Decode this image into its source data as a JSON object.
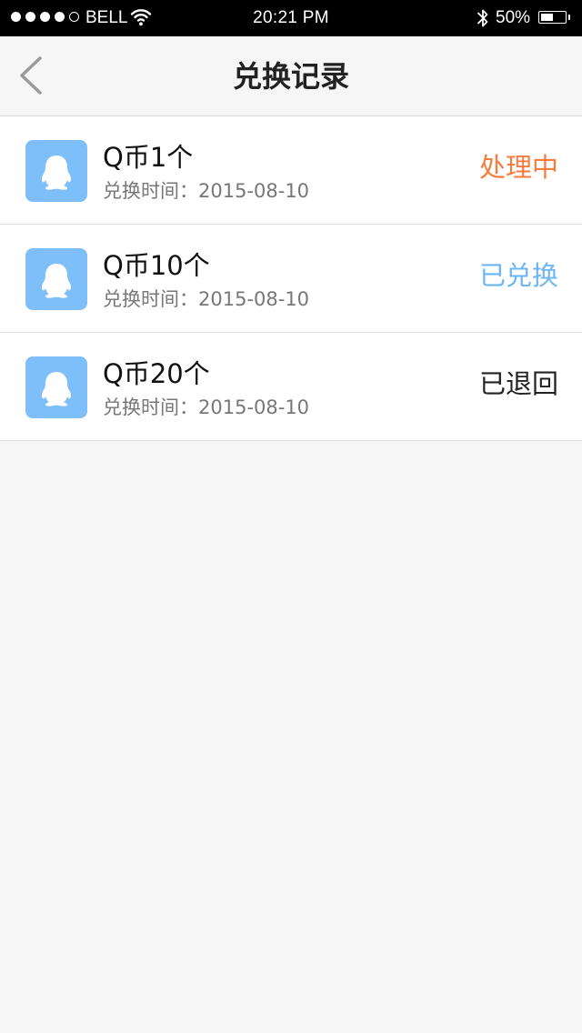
{
  "status_bar": {
    "carrier": "BELL",
    "time": "20:21  PM",
    "battery_text": "50%",
    "battery_level": 0.5,
    "signal_bars_filled": 4,
    "signal_bars_total": 5
  },
  "nav": {
    "title": "兑换记录",
    "back_icon": "chevron-left-icon"
  },
  "records": [
    {
      "icon": "qq-penguin-icon",
      "title": "Q币1个",
      "time": "兑换时间：2015-08-10",
      "status": "处理中",
      "status_color": "#f97b3e"
    },
    {
      "icon": "qq-penguin-icon",
      "title": "Q币10个",
      "time": "兑换时间：2015-08-10",
      "status": "已兑换",
      "status_color": "#6cb6f4"
    },
    {
      "icon": "qq-penguin-icon",
      "title": "Q币20个",
      "time": "兑换时间：2015-08-10",
      "status": "已退回",
      "status_color": "#222222"
    }
  ],
  "colors": {
    "icon_tile": "#7ebff9",
    "background": "#f6f6f6"
  }
}
